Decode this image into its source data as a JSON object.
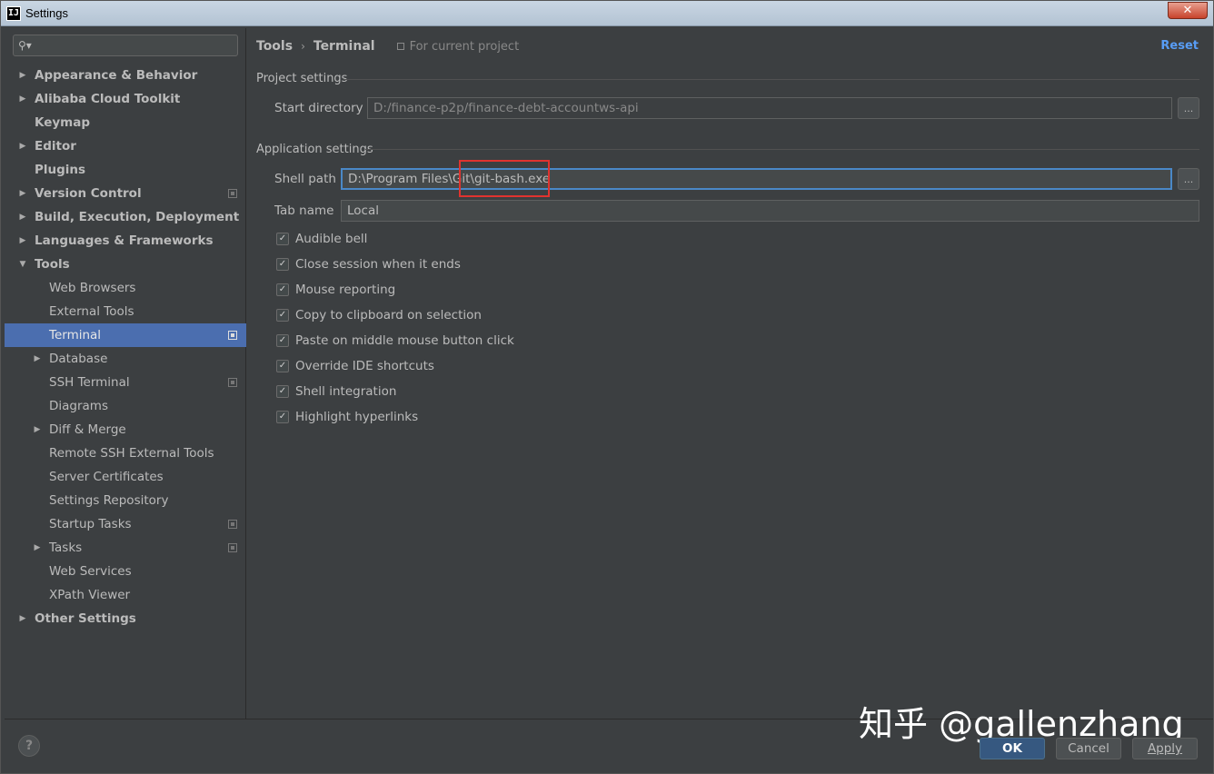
{
  "window": {
    "title": "Settings",
    "app_icon": "IJ",
    "close_symbol": "✕"
  },
  "sidebar": {
    "search_placeholder": "",
    "items": [
      {
        "label": "Appearance & Behavior",
        "level": 0,
        "arrow": "right",
        "bold": true
      },
      {
        "label": "Alibaba Cloud Toolkit",
        "level": 0,
        "arrow": "right",
        "bold": true
      },
      {
        "label": "Keymap",
        "level": 0,
        "arrow": "none",
        "bold": true
      },
      {
        "label": "Editor",
        "level": 0,
        "arrow": "right",
        "bold": true
      },
      {
        "label": "Plugins",
        "level": 0,
        "arrow": "none",
        "bold": true
      },
      {
        "label": "Version Control",
        "level": 0,
        "arrow": "right",
        "bold": true,
        "project": true
      },
      {
        "label": "Build, Execution, Deployment",
        "level": 0,
        "arrow": "right",
        "bold": true
      },
      {
        "label": "Languages & Frameworks",
        "level": 0,
        "arrow": "right",
        "bold": true
      },
      {
        "label": "Tools",
        "level": 0,
        "arrow": "down",
        "bold": true
      },
      {
        "label": "Web Browsers",
        "level": 1,
        "arrow": "none"
      },
      {
        "label": "External Tools",
        "level": 1,
        "arrow": "none"
      },
      {
        "label": "Terminal",
        "level": 1,
        "arrow": "none",
        "selected": true,
        "project": true
      },
      {
        "label": "Database",
        "level": 1,
        "arrow": "right"
      },
      {
        "label": "SSH Terminal",
        "level": 1,
        "arrow": "none",
        "project": true
      },
      {
        "label": "Diagrams",
        "level": 1,
        "arrow": "none"
      },
      {
        "label": "Diff & Merge",
        "level": 1,
        "arrow": "right"
      },
      {
        "label": "Remote SSH External Tools",
        "level": 1,
        "arrow": "none"
      },
      {
        "label": "Server Certificates",
        "level": 1,
        "arrow": "none"
      },
      {
        "label": "Settings Repository",
        "level": 1,
        "arrow": "none"
      },
      {
        "label": "Startup Tasks",
        "level": 1,
        "arrow": "none",
        "project": true
      },
      {
        "label": "Tasks",
        "level": 1,
        "arrow": "right",
        "project": true
      },
      {
        "label": "Web Services",
        "level": 1,
        "arrow": "none"
      },
      {
        "label": "XPath Viewer",
        "level": 1,
        "arrow": "none"
      },
      {
        "label": "Other Settings",
        "level": 0,
        "arrow": "right",
        "bold": true
      }
    ]
  },
  "main": {
    "breadcrumb": [
      "Tools",
      "Terminal"
    ],
    "breadcrumb_sep": "›",
    "scope": "For current project",
    "reset_label": "Reset",
    "project_section": "Project settings",
    "start_directory_label": "Start directory",
    "start_directory_value": "D:/finance-p2p/finance-debt-accountws-api",
    "application_section": "Application settings",
    "shell_path_label": "Shell path",
    "shell_path_value": "D:\\Program Files\\Git\\git-bash.exe",
    "tab_name_label": "Tab name",
    "tab_name_value": "Local",
    "browse_label": "...",
    "checkboxes": [
      {
        "label": "Audible bell",
        "checked": true
      },
      {
        "label": "Close session when it ends",
        "checked": true
      },
      {
        "label": "Mouse reporting",
        "checked": true
      },
      {
        "label": "Copy to clipboard on selection",
        "checked": true
      },
      {
        "label": "Paste on middle mouse button click",
        "checked": true
      },
      {
        "label": "Override IDE shortcuts",
        "checked": true
      },
      {
        "label": "Shell integration",
        "checked": true
      },
      {
        "label": "Highlight hyperlinks",
        "checked": true
      }
    ]
  },
  "footer": {
    "help_label": "?",
    "watermark": "知乎 @gallenzhang",
    "ok_label": "OK",
    "cancel_label": "Cancel",
    "apply_label": "Apply"
  },
  "colors": {
    "background": "#3c3f41",
    "selection": "#4b6eaf",
    "link": "#589df6",
    "focus_border": "#4a88c7",
    "highlight_box": "#e0332f"
  }
}
